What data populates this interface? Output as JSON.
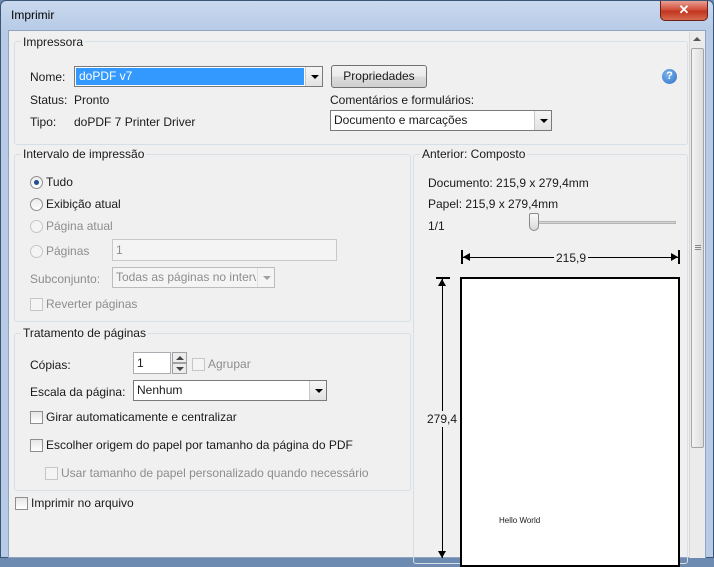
{
  "window": {
    "title": "Imprimir",
    "close_glyph": "✕"
  },
  "printer": {
    "legend": "Impressora",
    "name_label": "Nome:",
    "name_value": "doPDF v7",
    "properties_button": "Propriedades",
    "status_label": "Status:",
    "status_value": "Pronto",
    "type_label": "Tipo:",
    "type_value": "doPDF 7 Printer Driver",
    "comments_label": "Comentários e formulários:",
    "comments_value": "Documento e marcações",
    "help_glyph": "?"
  },
  "range": {
    "legend": "Intervalo de impressão",
    "options": [
      "Tudo",
      "Exibição atual",
      "Página atual",
      "Páginas"
    ],
    "selected": "Tudo",
    "pages_value": "1",
    "subset_label": "Subconjunto:",
    "subset_value": "Todas as páginas no interv",
    "reverse_label": "Reverter páginas"
  },
  "handling": {
    "legend": "Tratamento de páginas",
    "copies_label": "Cópias:",
    "copies_value": "1",
    "collate_label": "Agrupar",
    "scale_label": "Escala da página:",
    "scale_value": "Nenhum",
    "auto_rotate_label": "Girar automaticamente e centralizar",
    "paper_source_label": "Escolher origem do papel por tamanho da página do PDF",
    "custom_paper_label": "Usar tamanho de papel personalizado quando necessário"
  },
  "print_to_file_label": "Imprimir no arquivo",
  "preview": {
    "legend": "Anterior: Composto",
    "document_text": "Documento: 215,9 x 279,4mm",
    "paper_text": "Papel: 215,9 x 279,4mm",
    "page_counter": "1/1",
    "width_label": "215,9",
    "height_label": "279,4",
    "page_content": "Hello World"
  }
}
